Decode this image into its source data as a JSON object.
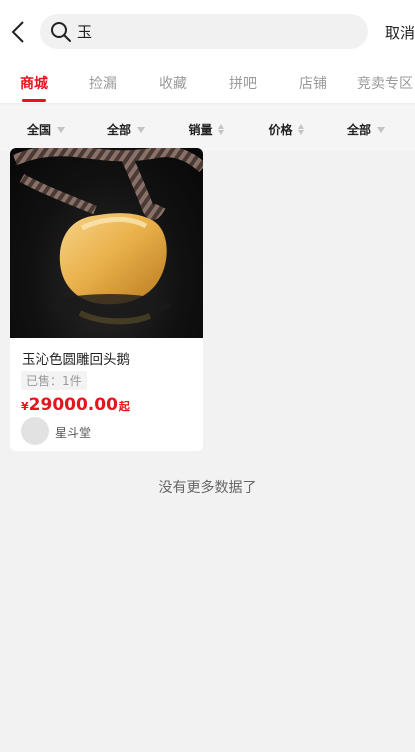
{
  "header": {
    "back_icon": "chevron-left-icon",
    "search_icon": "search-icon",
    "search_value": "玉",
    "cancel_label": "取消"
  },
  "tabs": [
    {
      "label": "商城",
      "active": true
    },
    {
      "label": "捡漏",
      "active": false
    },
    {
      "label": "收藏",
      "active": false
    },
    {
      "label": "拼吧",
      "active": false
    },
    {
      "label": "店铺",
      "active": false
    },
    {
      "label": "竞卖专区",
      "active": false
    }
  ],
  "filters": {
    "region": "全国",
    "category": "全部",
    "sales": "销量",
    "price": "价格",
    "all": "全部"
  },
  "products": [
    {
      "title": "玉沁色圆雕回头鹅",
      "sold": "已售：1件",
      "currency": "¥",
      "price": "29000.00",
      "price_suffix": "起",
      "shop_name": "星斗堂"
    }
  ],
  "footer": {
    "no_more": "没有更多数据了"
  },
  "colors": {
    "accent": "#e4151d",
    "background": "#f2f2f2"
  }
}
